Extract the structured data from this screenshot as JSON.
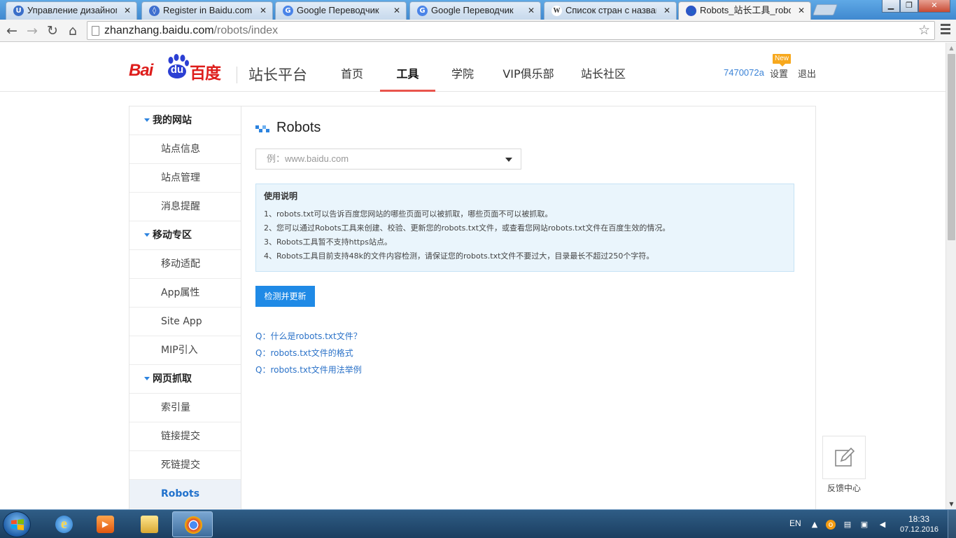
{
  "browser": {
    "tabs": [
      {
        "label": "Управление дизайном - ",
        "favicon": "U",
        "color": "#3a6fc9"
      },
      {
        "label": "Register in Baidu.com",
        "favicon": "◊",
        "color": "#3f6fcf"
      },
      {
        "label": "Google Переводчик",
        "favicon": "G",
        "color": "#4a84e8"
      },
      {
        "label": "Google Переводчик",
        "favicon": "G",
        "color": "#4a84e8"
      },
      {
        "label": "Список стран с названия",
        "favicon": "W",
        "color": "#333333"
      },
      {
        "label": "Robots_站长工具_robots文",
        "favicon": "🐾",
        "color": "#2c56c6"
      }
    ],
    "url_host": "zhanzhang.baidu.com",
    "url_path": "/robots/index"
  },
  "header": {
    "logo_text": "Bai",
    "logo_du": "du",
    "logo_cn": "百度",
    "site_title": "站长平台",
    "nav": [
      "首页",
      "工具",
      "学院",
      "VIP俱乐部",
      "站长社区"
    ],
    "active_nav": "工具",
    "user_id": "7470072a",
    "settings_label": "设置",
    "new_badge": "New",
    "logout_label": "退出"
  },
  "sidebar": {
    "items": [
      {
        "label": "我的网站",
        "type": "group"
      },
      {
        "label": "站点信息",
        "type": "link"
      },
      {
        "label": "站点管理",
        "type": "link"
      },
      {
        "label": "消息提醒",
        "type": "link"
      },
      {
        "label": "移动专区",
        "type": "group"
      },
      {
        "label": "移动适配",
        "type": "link"
      },
      {
        "label": "App属性",
        "type": "link"
      },
      {
        "label": "Site App",
        "type": "link"
      },
      {
        "label": "MIP引入",
        "type": "link"
      },
      {
        "label": "网页抓取",
        "type": "group"
      },
      {
        "label": "索引量",
        "type": "link"
      },
      {
        "label": "链接提交",
        "type": "link"
      },
      {
        "label": "死链提交",
        "type": "link"
      },
      {
        "label": "Robots",
        "type": "link",
        "active": true
      }
    ]
  },
  "content": {
    "title": "Robots",
    "site_select_placeholder": "例：www.baidu.com",
    "info_title": "使用说明",
    "info_lines": [
      "1、robots.txt可以告诉百度您网站的哪些页面可以被抓取，哪些页面不可以被抓取。",
      "2、您可以通过Robots工具来创建、校验、更新您的robots.txt文件，或查看您网站robots.txt文件在百度生效的情况。",
      "3、Robots工具暂不支持https站点。",
      "4、Robots工具目前支持48k的文件内容检测，请保证您的robots.txt文件不要过大，目录最长不超过250个字符。"
    ],
    "check_button": "检测并更新",
    "faq": [
      "Q：什么是robots.txt文件？",
      "Q：robots.txt文件的格式",
      "Q：robots.txt文件用法举例"
    ]
  },
  "feedback": {
    "label": "反馈中心",
    "icon": "edit-icon"
  },
  "taskbar": {
    "lang": "EN",
    "time": "18:33",
    "date": "07.12.2016"
  },
  "colors": {
    "accent_red": "#e9544d",
    "link_blue": "#2b72c8",
    "button_blue": "#1f8ae6",
    "info_bg": "#eaf5fc"
  }
}
